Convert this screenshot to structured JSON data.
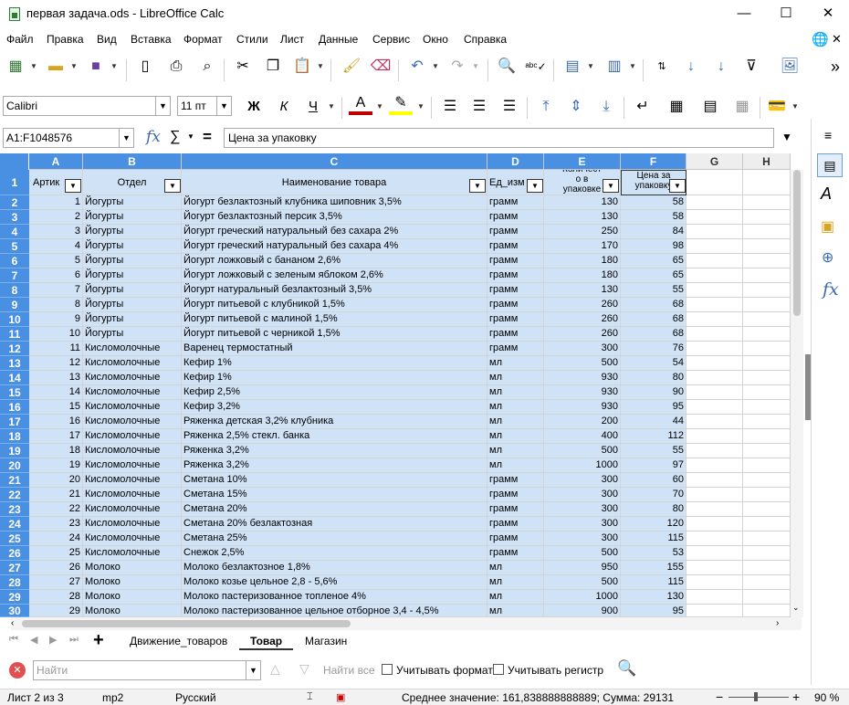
{
  "window": {
    "title": "первая задача.ods - LibreOffice Calc",
    "minimize": "—",
    "maximize": "☐",
    "close": "✕"
  },
  "menu": [
    "Файл",
    "Правка",
    "Вид",
    "Вставка",
    "Формат",
    "Стили",
    "Лист",
    "Данные",
    "Сервис",
    "Окно",
    "Справка"
  ],
  "format_toolbar": {
    "font_name": "Calibri",
    "font_size": "11 пт",
    "bold": "Ж",
    "italic": "К",
    "underline": "Ч",
    "font_color_letter": "A"
  },
  "formula_bar": {
    "name_box": "A1:F1048576",
    "fx": "fx",
    "sigma": "∑",
    "equals": "=",
    "content": "Цена за упаковку"
  },
  "columns": [
    "A",
    "B",
    "C",
    "D",
    "E",
    "F",
    "G",
    "H"
  ],
  "headers": {
    "A": "Артик",
    "B": "Отдел",
    "C": "Наименование товара",
    "D": "Ед_изм",
    "E": "Количест\nо в\nупаковке",
    "F": "Цена за\nупаковку"
  },
  "rows": [
    {
      "n": "2",
      "a": "1",
      "b": "Йогурты",
      "c": "Йогурт безлактозный клубника шиповник 3,5%",
      "d": "грамм",
      "e": "130",
      "f": "58"
    },
    {
      "n": "3",
      "a": "2",
      "b": "Йогурты",
      "c": "Йогурт безлактозный персик 3,5%",
      "d": "грамм",
      "e": "130",
      "f": "58"
    },
    {
      "n": "4",
      "a": "3",
      "b": "Йогурты",
      "c": "Йогурт греческий натуральный без сахара 2%",
      "d": "грамм",
      "e": "250",
      "f": "84"
    },
    {
      "n": "5",
      "a": "4",
      "b": "Йогурты",
      "c": "Йогурт греческий натуральный без сахара 4%",
      "d": "грамм",
      "e": "170",
      "f": "98"
    },
    {
      "n": "6",
      "a": "5",
      "b": "Йогурты",
      "c": "Йогурт ложковый с бананом 2,6%",
      "d": "грамм",
      "e": "180",
      "f": "65"
    },
    {
      "n": "7",
      "a": "6",
      "b": "Йогурты",
      "c": "Йогурт ложковый с зеленым яблоком 2,6%",
      "d": "грамм",
      "e": "180",
      "f": "65"
    },
    {
      "n": "8",
      "a": "7",
      "b": "Йогурты",
      "c": "Йогурт натуральный  безлактозный 3,5%",
      "d": "грамм",
      "e": "130",
      "f": "55"
    },
    {
      "n": "9",
      "a": "8",
      "b": "Йогурты",
      "c": "Йогурт питьевой с клубникой 1,5%",
      "d": "грамм",
      "e": "260",
      "f": "68"
    },
    {
      "n": "10",
      "a": "9",
      "b": "Йогурты",
      "c": "Йогурт питьевой с малиной 1,5%",
      "d": "грамм",
      "e": "260",
      "f": "68"
    },
    {
      "n": "11",
      "a": "10",
      "b": "Йогурты",
      "c": "Йогурт питьевой с черникой 1,5%",
      "d": "грамм",
      "e": "260",
      "f": "68"
    },
    {
      "n": "12",
      "a": "11",
      "b": "Кисломолочные",
      "c": "Варенец термостатный",
      "d": "грамм",
      "e": "300",
      "f": "76"
    },
    {
      "n": "13",
      "a": "12",
      "b": "Кисломолочные",
      "c": "Кефир 1%",
      "d": "мл",
      "e": "500",
      "f": "54"
    },
    {
      "n": "14",
      "a": "13",
      "b": "Кисломолочные",
      "c": "Кефир 1%",
      "d": "мл",
      "e": "930",
      "f": "80"
    },
    {
      "n": "15",
      "a": "14",
      "b": "Кисломолочные",
      "c": "Кефир 2,5%",
      "d": "мл",
      "e": "930",
      "f": "90"
    },
    {
      "n": "16",
      "a": "15",
      "b": "Кисломолочные",
      "c": "Кефир 3,2%",
      "d": "мл",
      "e": "930",
      "f": "95"
    },
    {
      "n": "17",
      "a": "16",
      "b": "Кисломолочные",
      "c": "Ряженка  детская 3,2% клубника",
      "d": "мл",
      "e": "200",
      "f": "44"
    },
    {
      "n": "18",
      "a": "17",
      "b": "Кисломолочные",
      "c": "Ряженка 2,5% стекл. банка",
      "d": "мл",
      "e": "400",
      "f": "112"
    },
    {
      "n": "19",
      "a": "18",
      "b": "Кисломолочные",
      "c": "Ряженка 3,2%",
      "d": "мл",
      "e": "500",
      "f": "55"
    },
    {
      "n": "20",
      "a": "19",
      "b": "Кисломолочные",
      "c": "Ряженка 3,2%",
      "d": "мл",
      "e": "1000",
      "f": "97"
    },
    {
      "n": "21",
      "a": "20",
      "b": "Кисломолочные",
      "c": "Сметана 10%",
      "d": "грамм",
      "e": "300",
      "f": "60"
    },
    {
      "n": "22",
      "a": "21",
      "b": "Кисломолочные",
      "c": "Сметана 15%",
      "d": "грамм",
      "e": "300",
      "f": "70"
    },
    {
      "n": "23",
      "a": "22",
      "b": "Кисломолочные",
      "c": "Сметана 20%",
      "d": "грамм",
      "e": "300",
      "f": "80"
    },
    {
      "n": "24",
      "a": "23",
      "b": "Кисломолочные",
      "c": "Сметана 20% безлактозная",
      "d": "грамм",
      "e": "300",
      "f": "120"
    },
    {
      "n": "25",
      "a": "24",
      "b": "Кисломолочные",
      "c": "Сметана 25%",
      "d": "грамм",
      "e": "300",
      "f": "115"
    },
    {
      "n": "26",
      "a": "25",
      "b": "Кисломолочные",
      "c": "Снежок 2,5%",
      "d": "грамм",
      "e": "500",
      "f": "53"
    },
    {
      "n": "27",
      "a": "26",
      "b": "Молоко",
      "c": "Молоко безлактозное 1,8%",
      "d": "мл",
      "e": "950",
      "f": "155"
    },
    {
      "n": "28",
      "a": "27",
      "b": "Молоко",
      "c": "Молоко козье цельное 2,8 - 5,6%",
      "d": "мл",
      "e": "500",
      "f": "115"
    },
    {
      "n": "29",
      "a": "28",
      "b": "Молоко",
      "c": "Молоко пастеризованное топленое 4%",
      "d": "мл",
      "e": "1000",
      "f": "130"
    },
    {
      "n": "30",
      "a": "29",
      "b": "Молоко",
      "c": "Молоко пастеризованное цельное отборное 3,4 - 4,5%",
      "d": "мл",
      "e": "900",
      "f": "95"
    }
  ],
  "sheet_tabs": [
    {
      "label": "Движение_товаров",
      "active": false
    },
    {
      "label": "Товар",
      "active": true
    },
    {
      "label": "Магазин",
      "active": false
    }
  ],
  "findbar": {
    "placeholder": "Найти",
    "find_all": "Найти все",
    "match_format": "Учитывать формат",
    "match_case": "Учитывать регистр"
  },
  "status": {
    "sheet": "Лист 2 из 3",
    "style": "mp2",
    "language": "Русский",
    "summary": "Среднее значение: 161,838888888889; Сумма: 29131",
    "zoom": "90 %"
  },
  "colors": {
    "selection": "#cfe2f6",
    "header_selected": "#4a90e2",
    "accent_green": "#2e7d32"
  }
}
